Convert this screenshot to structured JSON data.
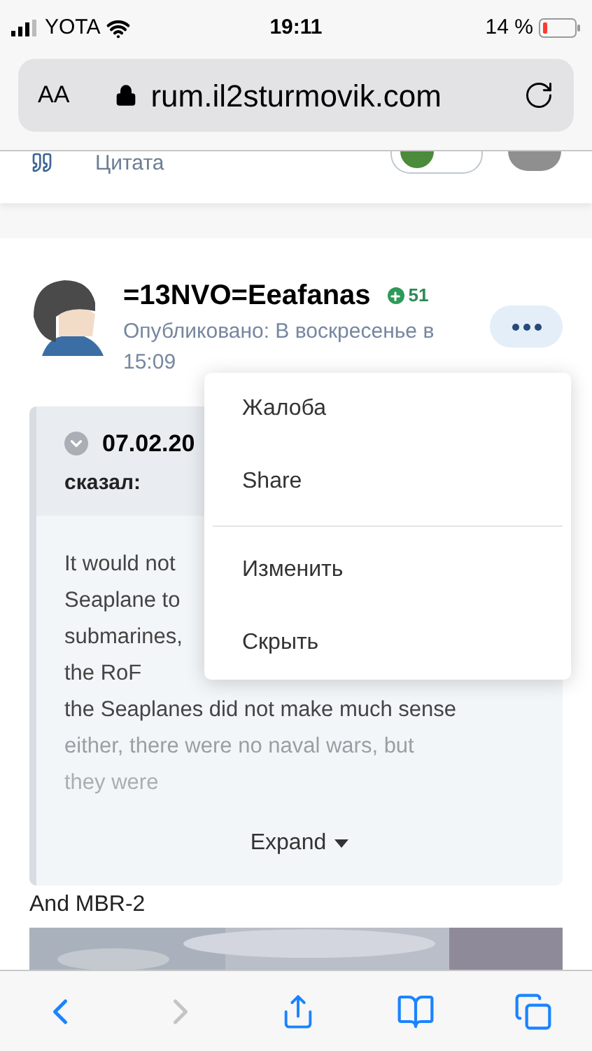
{
  "status_bar": {
    "carrier": "YOTA",
    "time": "19:11",
    "battery": "14 %"
  },
  "address_bar": {
    "text_size": "AA",
    "url": "rum.il2sturmovik.com"
  },
  "toolbar_strip": {
    "label": "Цитата"
  },
  "post": {
    "author": "=13NVO=Eeafanas",
    "reputation": "51",
    "published": "Опубликовано: В воскресенье в",
    "time": "15:09",
    "quote": {
      "date": "07.02.20",
      "said": "сказал:",
      "lines": [
        "It would not",
        "Seaplane to",
        "submarines,",
        "the RoF",
        "the Seaplanes did not make much sense",
        "either, there were no naval wars, but",
        "they were"
      ],
      "expand": "Expand"
    },
    "text": "And MBR-2"
  },
  "menu": {
    "open": true,
    "items": [
      {
        "label": "Жалоба",
        "divider_after": false
      },
      {
        "label": "Share",
        "divider_after": true
      },
      {
        "label": "Изменить",
        "divider_after": false
      },
      {
        "label": "Скрыть",
        "divider_after": false
      }
    ]
  }
}
